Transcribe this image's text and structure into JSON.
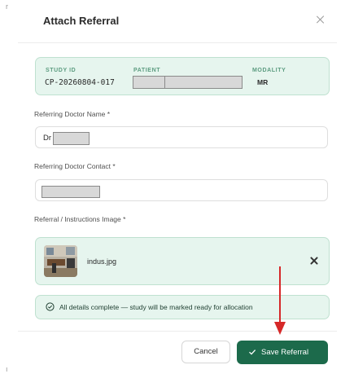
{
  "modal": {
    "title": "Attach Referral",
    "study": {
      "study_id_label": "STUDY ID",
      "study_id_value": "CP-20260804-017",
      "patient_label": "PATIENT",
      "modality_label": "MODALITY",
      "modality_value": "MR"
    },
    "fields": {
      "doctor_name_label": "Referring Doctor Name *",
      "doctor_name_value": "Dr",
      "doctor_contact_label": "Referring Doctor Contact *",
      "image_label": "Referral / Instructions Image *"
    },
    "attachment": {
      "file_name": "indus.jpg"
    },
    "status_message": "All details complete — study will be marked ready for allocation",
    "buttons": {
      "cancel_label": "Cancel",
      "save_label": "Save Referral"
    },
    "colors": {
      "accent": "#1c6a4b",
      "panel_bg": "#e6f5ee",
      "panel_border": "#bfe1d0",
      "annotation_arrow": "#d62828"
    },
    "icons": [
      "close-icon",
      "check-circle-icon",
      "check-icon",
      "remove-file-icon"
    ]
  }
}
